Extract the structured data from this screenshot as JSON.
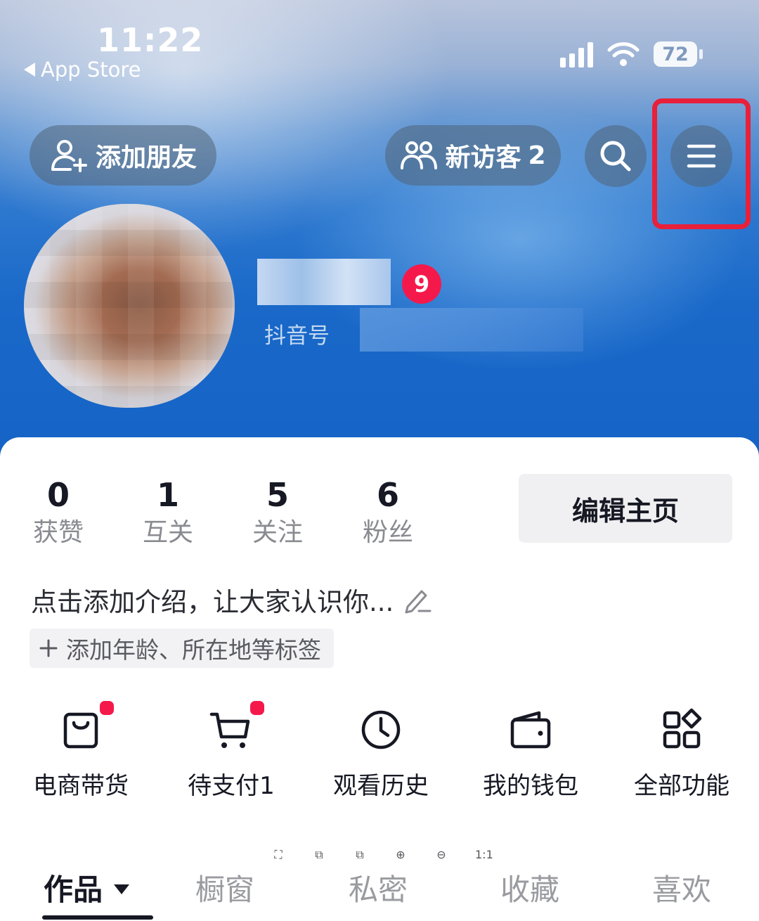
{
  "status_bar": {
    "time": "11:22",
    "back_label": "App Store",
    "battery": "72"
  },
  "top_bar": {
    "add_friend": "添加朋友",
    "new_visitors_label": "新访客",
    "new_visitors_count": "2"
  },
  "profile": {
    "notification_badge": "9",
    "douyin_id_label": "抖音号"
  },
  "stats": [
    {
      "value": "0",
      "label": "获赞"
    },
    {
      "value": "1",
      "label": "互关"
    },
    {
      "value": "5",
      "label": "关注"
    },
    {
      "value": "6",
      "label": "粉丝"
    }
  ],
  "edit_profile": "编辑主页",
  "intro": "点击添加介绍，让大家认识你...",
  "tag_chip": "添加年龄、所在地等标签",
  "tools": [
    {
      "label": "电商带货",
      "icon": "shopping-bag-icon"
    },
    {
      "label": "待支付1",
      "icon": "cart-icon"
    },
    {
      "label": "观看历史",
      "icon": "clock-icon"
    },
    {
      "label": "我的钱包",
      "icon": "wallet-icon"
    },
    {
      "label": "全部功能",
      "icon": "grid-icon"
    }
  ],
  "mini_tools": [
    "⛶",
    "⧉",
    "⧉",
    "⊕",
    "⊖",
    "1:1"
  ],
  "tabs": [
    {
      "label": "作品"
    },
    {
      "label": "橱窗"
    },
    {
      "label": "私密"
    },
    {
      "label": "收藏"
    },
    {
      "label": "喜欢"
    }
  ],
  "colors": {
    "accent_red": "#f5194b",
    "highlight": "#e8203a",
    "text_primary": "#161823"
  }
}
